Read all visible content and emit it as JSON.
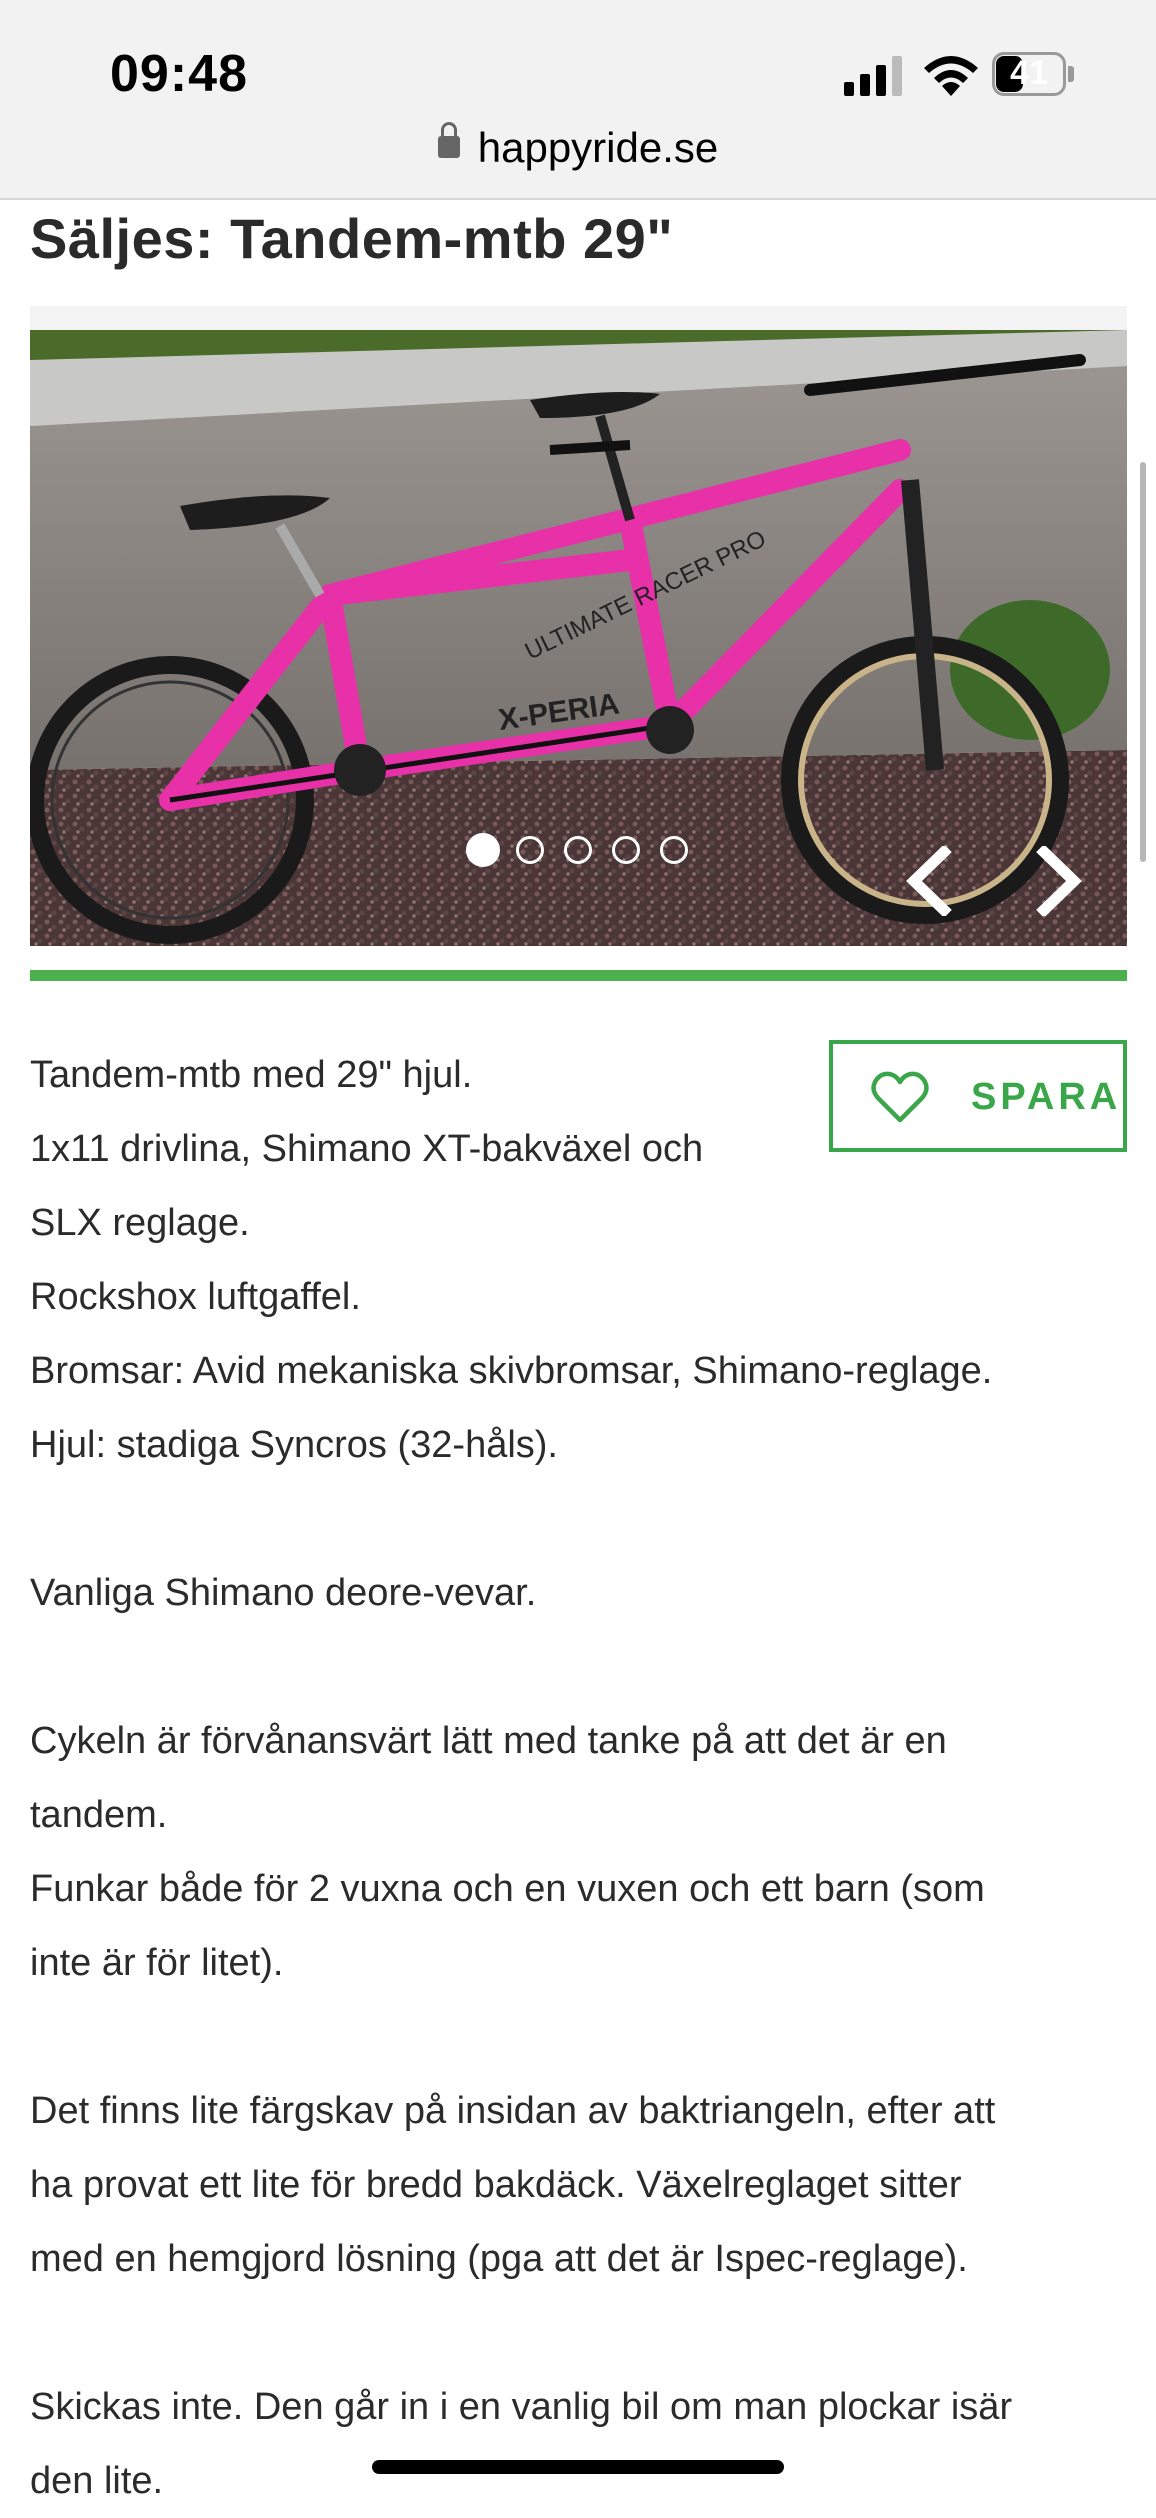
{
  "status_bar": {
    "time": "09:48",
    "battery": "41",
    "battery_level": 0.41
  },
  "browser": {
    "url": "happyride.se"
  },
  "listing": {
    "title": "Säljes: Tandem-mtb 29\"",
    "gallery": {
      "photo_count": 5,
      "active_index": 0
    },
    "save_label": "SPARA",
    "description": {
      "line1": "Tandem-mtb med 29\" hjul.",
      "line2": "1x11 drivlina, Shimano XT-bakväxel och",
      "line3": "SLX reglage.",
      "line4": "Rockshox luftgaffel.",
      "line5": "Bromsar: Avid mekaniska skivbromsar, Shimano-reglage.",
      "line6": "Hjul: stadiga Syncros (32-håls).",
      "line7": "Vanliga Shimano deore-vevar.",
      "line8": "Cykeln är förvånansvärt lätt med tanke på att det är en",
      "line9": "tandem.",
      "line10": "Funkar både för 2 vuxna och en vuxen och ett barn (som",
      "line11": "inte är för litet).",
      "line12": "Det finns lite färgskav på insidan av baktriangeln, efter att",
      "line13": "ha provat ett lite för bredd bakdäck. Växelreglaget sitter",
      "line14": "med en hemgjord lösning (pga att det är Ispec-reglage).",
      "line15": "Skickas inte. Den går in i en vanlig bil om man plockar isär",
      "line16": "den lite."
    }
  },
  "colors": {
    "accent_green": "#3aa64a",
    "bike_pink": "#e830a8"
  }
}
